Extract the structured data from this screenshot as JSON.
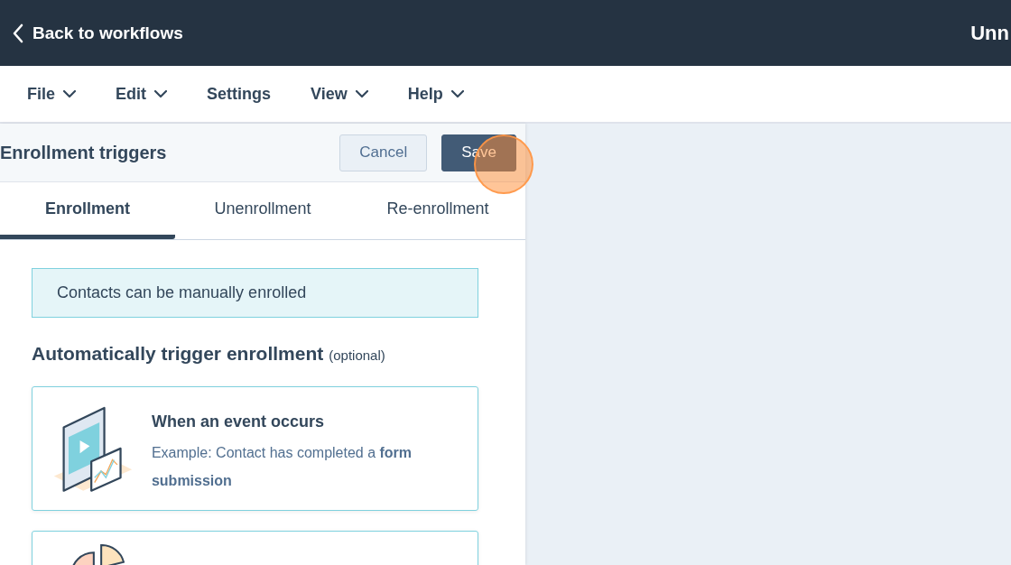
{
  "header": {
    "back_link": "Back to workflows",
    "title": "Unn"
  },
  "menu": [
    {
      "label": "File",
      "dropdown": true
    },
    {
      "label": "Edit",
      "dropdown": true
    },
    {
      "label": "Settings",
      "dropdown": false
    },
    {
      "label": "View",
      "dropdown": true
    },
    {
      "label": "Help",
      "dropdown": true
    }
  ],
  "panel": {
    "title": "Enrollment triggers",
    "buttons": [
      {
        "label": "Cancel",
        "kind": "secondary"
      },
      {
        "label": "Save",
        "kind": "primary"
      }
    ],
    "tabs": [
      {
        "label": "Enrollment",
        "selected": true
      },
      {
        "label": "Unenrollment",
        "selected": false
      },
      {
        "label": "Re-enrollment",
        "selected": false
      }
    ],
    "notice": "Contacts can be manually enrolled",
    "section_title": "Automatically trigger enrollment",
    "section_note": "(optional)",
    "cards": [
      {
        "kind": "event",
        "title": "When an event occurs",
        "description": "Example: Contact has completed a **form submission**"
      },
      {
        "kind": "filter"
      }
    ]
  }
}
